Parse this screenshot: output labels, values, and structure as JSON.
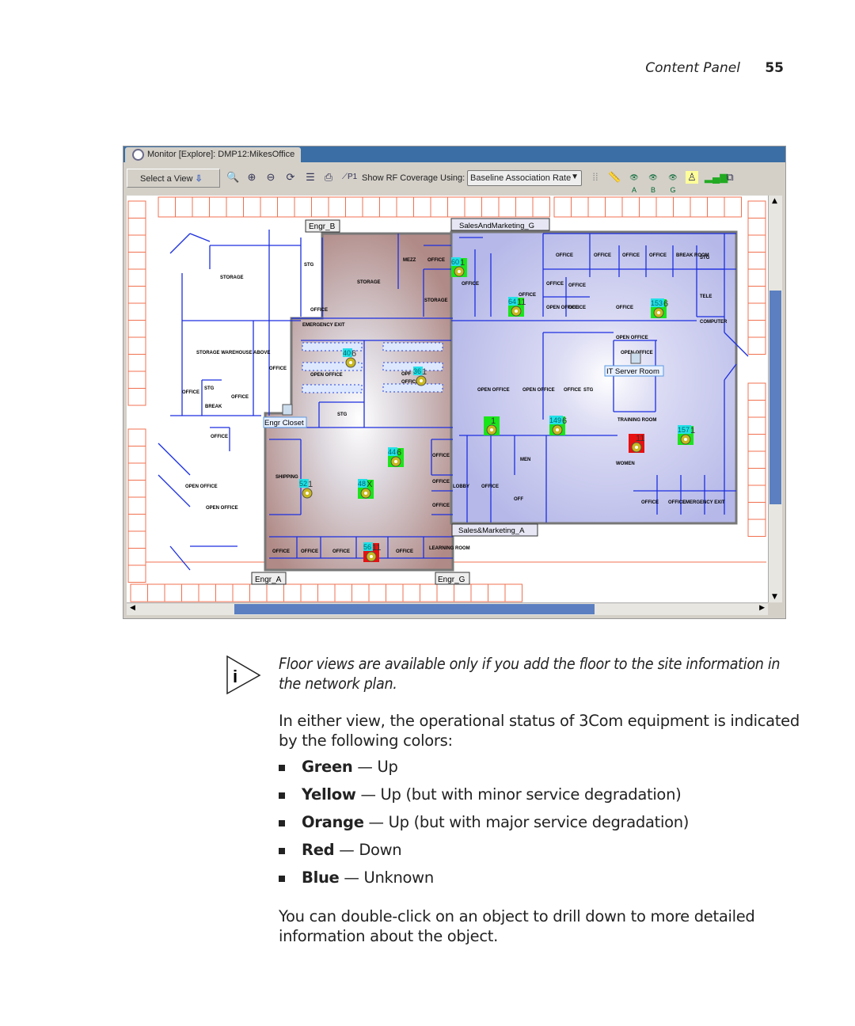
{
  "header": {
    "section": "Content Panel",
    "page_number": "55"
  },
  "window": {
    "title": "Monitor [Explore]: DMP12:MikesOffice"
  },
  "toolbar": {
    "select_view": "Select a View",
    "icons": [
      "search-icon",
      "zoom-in-icon",
      "zoom-out-icon",
      "refresh-icon",
      "list-icon",
      "print-icon",
      "path-p1-icon"
    ],
    "rf_label": "Show RF Coverage Using:",
    "rf_value": "Baseline Association Rate",
    "right_icons": [
      "grid-icon",
      "ruler-icon",
      "radio-a-icon",
      "radio-b-icon",
      "radio-g-icon",
      "person-icon",
      "signal-icon",
      "3d-box-icon"
    ]
  },
  "colors": {
    "engr_zone": "#b98d88",
    "sales_zone": "#b8bbe8",
    "walls": "#1c2fe0",
    "outer_rooms": "#f07050",
    "ap_green": "#19e619",
    "ap_red": "#e81010",
    "ap_channel": "#22e0e8"
  },
  "zones": {
    "engr_b": "Engr_B",
    "sales_g": "SalesAndMarketing_G",
    "engr_a": "Engr_A",
    "engr_g": "Engr_G",
    "sales_a": "Sales&Marketing_A",
    "it_server": "IT Server Room",
    "engr_closet": "Engr Closet"
  },
  "rooms": [
    "STORAGE",
    "STG",
    "STORAGE WAREHOUSE ABOVE",
    "OFFICE",
    "MEZZ",
    "OFFICE",
    "STORAGE",
    "STORAGE",
    "OFFICE",
    "EMERGENCY EXIT",
    "OFFICE",
    "OPEN OFFICE",
    "OPF",
    "OFFICE",
    "STG",
    "BREAK",
    "STG",
    "OFFICE",
    "OFFICE",
    "OPEN OFFICE",
    "OPEN OFFICE",
    "OPEN OFFICE",
    "OFFICE",
    "OFFICE",
    "OFFICE",
    "OFFICE",
    "OFFICE",
    "OFFICE",
    "OFFICE",
    "OFFICE",
    "LEARNING ROOM",
    "SHIPPING",
    "OFFICE",
    "OFFICE",
    "OFFICE",
    "OFFICE",
    "OFFICE",
    "BREAK ROOM",
    "STG",
    "OFFICE",
    "OFFICE",
    "OFFICE",
    "OPEN OFFICE",
    "OFFICE",
    "OFFICE",
    "TELE",
    "COMPUTER",
    "OPEN OFFICE",
    "OPEN OFFICE",
    "STG",
    "OPEN OFFICE",
    "TRAINING ROOM",
    "WOMEN",
    "MEN",
    "LOBBY",
    "OFFICE",
    "OFF",
    "OFFICE",
    "OFFICE",
    "EMERGENCY EXIT"
  ],
  "access_points": [
    {
      "id": "60",
      "channel": "1",
      "status": "green"
    },
    {
      "id": "64",
      "channel": "11",
      "status": "green"
    },
    {
      "id": "153",
      "channel": "6",
      "status": "green"
    },
    {
      "id": "40",
      "channel": "6",
      "status": "none"
    },
    {
      "id": "36",
      "channel": "1",
      "status": "none"
    },
    {
      "id": "",
      "channel": "1",
      "status": "green"
    },
    {
      "id": "149",
      "channel": "6",
      "status": "green"
    },
    {
      "id": "",
      "channel": "11",
      "status": "red"
    },
    {
      "id": "157",
      "channel": "1",
      "status": "green"
    },
    {
      "id": "44",
      "channel": "6",
      "status": "green"
    },
    {
      "id": "52",
      "channel": "1",
      "status": "none"
    },
    {
      "id": "48",
      "channel": "X",
      "status": "green"
    },
    {
      "id": "56",
      "channel": "11",
      "status": "red"
    }
  ],
  "note": "Floor views are available only if you add the floor to the site information in the network plan.",
  "intro": "In either view, the operational status of 3Com equipment is indicated by the following colors:",
  "status_list": [
    {
      "color": "Green",
      "meaning": "— Up"
    },
    {
      "color": "Yellow",
      "meaning": "— Up (but with minor service degradation)"
    },
    {
      "color": "Orange",
      "meaning": "— Up (but with major service degradation)"
    },
    {
      "color": "Red",
      "meaning": "— Down"
    },
    {
      "color": "Blue",
      "meaning": "— Unknown"
    }
  ],
  "closing": "You can double-click on an object to drill down to more detailed information about the object."
}
